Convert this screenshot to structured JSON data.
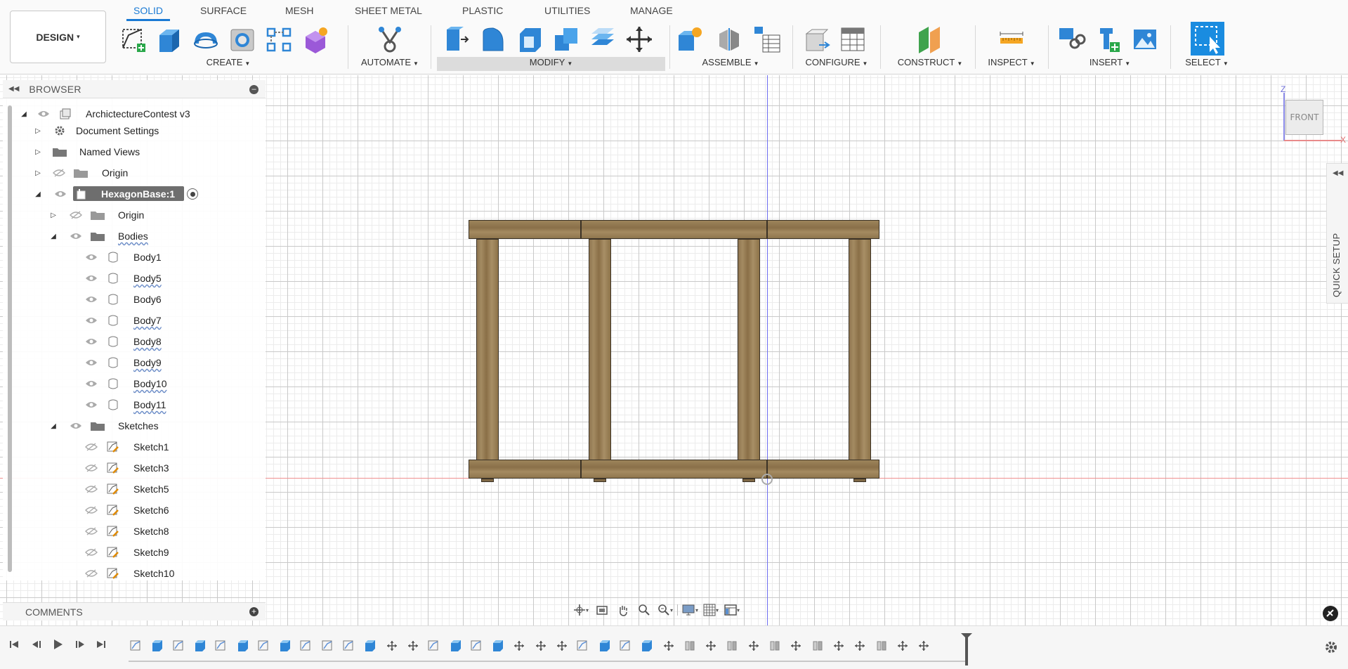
{
  "tabs": [
    "SOLID",
    "SURFACE",
    "MESH",
    "SHEET METAL",
    "PLASTIC",
    "UTILITIES",
    "MANAGE"
  ],
  "active_tab": "SOLID",
  "workspace": {
    "label": "DESIGN",
    "caret": "▾"
  },
  "groups": {
    "create": "CREATE",
    "automate": "AUTOMATE",
    "modify": "MODIFY",
    "assemble": "ASSEMBLE",
    "configure": "CONFIGURE",
    "construct": "CONSTRUCT",
    "inspect": "INSPECT",
    "insert": "INSERT",
    "select": "SELECT"
  },
  "browser": {
    "title": "BROWSER",
    "root": "ArchictectureContest v3",
    "document_settings": "Document Settings",
    "named_views": "Named Views",
    "origin": "Origin",
    "component": "HexagonBase:1",
    "component_origin": "Origin",
    "bodies_folder": "Bodies",
    "bodies": [
      "Body1",
      "Body5",
      "Body6",
      "Body7",
      "Body8",
      "Body9",
      "Body10",
      "Body11"
    ],
    "sketches_folder": "Sketches",
    "sketches": [
      "Sketch1",
      "Sketch3",
      "Sketch5",
      "Sketch6",
      "Sketch8",
      "Sketch9",
      "Sketch10"
    ]
  },
  "comments": {
    "title": "COMMENTS"
  },
  "viewcube": {
    "face": "FRONT",
    "axis_z": "Z",
    "axis_x": "X"
  },
  "quick_setup": {
    "label": "QUICK SETUP"
  },
  "colors": {
    "accent": "#1a7ad4",
    "axis_blue": "#6f6ff0",
    "axis_red": "#f09090",
    "wood": "#9b8258"
  },
  "timeline": {
    "controls": [
      "skip-to-start-icon",
      "step-back-icon",
      "play-icon",
      "step-forward-icon",
      "skip-to-end-icon"
    ],
    "features": [
      "sketch",
      "extrude",
      "sketch",
      "extrude",
      "sketch",
      "extrude",
      "sketch",
      "extrude",
      "sketch",
      "sketch",
      "sketch",
      "extrude",
      "move",
      "move",
      "sketch",
      "extrude",
      "sketch",
      "extrude",
      "move",
      "move",
      "move",
      "sketch",
      "extrude",
      "sketch",
      "extrude",
      "move",
      "joint",
      "move",
      "joint",
      "move",
      "joint",
      "move",
      "joint",
      "move",
      "move",
      "joint",
      "move",
      "move"
    ]
  }
}
